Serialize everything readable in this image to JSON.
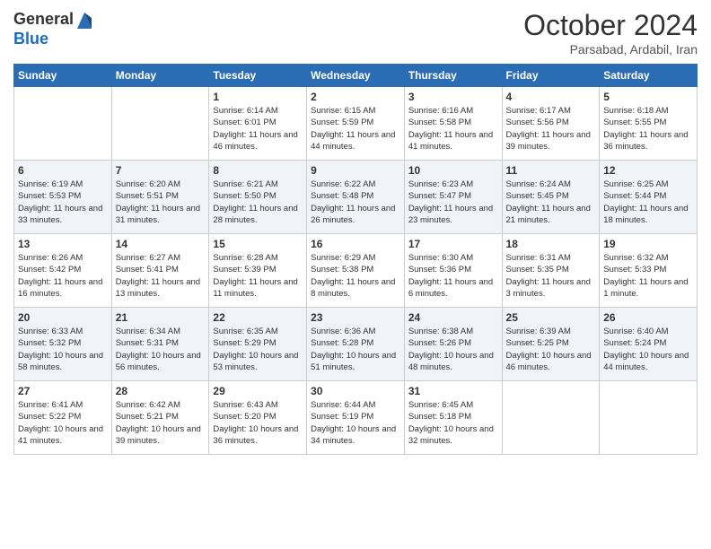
{
  "header": {
    "logo_line1": "General",
    "logo_line2": "Blue",
    "month": "October 2024",
    "location": "Parsabad, Ardabil, Iran"
  },
  "days_of_week": [
    "Sunday",
    "Monday",
    "Tuesday",
    "Wednesday",
    "Thursday",
    "Friday",
    "Saturday"
  ],
  "weeks": [
    [
      {
        "day": "",
        "info": ""
      },
      {
        "day": "",
        "info": ""
      },
      {
        "day": "1",
        "info": "Sunrise: 6:14 AM\nSunset: 6:01 PM\nDaylight: 11 hours and 46 minutes."
      },
      {
        "day": "2",
        "info": "Sunrise: 6:15 AM\nSunset: 5:59 PM\nDaylight: 11 hours and 44 minutes."
      },
      {
        "day": "3",
        "info": "Sunrise: 6:16 AM\nSunset: 5:58 PM\nDaylight: 11 hours and 41 minutes."
      },
      {
        "day": "4",
        "info": "Sunrise: 6:17 AM\nSunset: 5:56 PM\nDaylight: 11 hours and 39 minutes."
      },
      {
        "day": "5",
        "info": "Sunrise: 6:18 AM\nSunset: 5:55 PM\nDaylight: 11 hours and 36 minutes."
      }
    ],
    [
      {
        "day": "6",
        "info": "Sunrise: 6:19 AM\nSunset: 5:53 PM\nDaylight: 11 hours and 33 minutes."
      },
      {
        "day": "7",
        "info": "Sunrise: 6:20 AM\nSunset: 5:51 PM\nDaylight: 11 hours and 31 minutes."
      },
      {
        "day": "8",
        "info": "Sunrise: 6:21 AM\nSunset: 5:50 PM\nDaylight: 11 hours and 28 minutes."
      },
      {
        "day": "9",
        "info": "Sunrise: 6:22 AM\nSunset: 5:48 PM\nDaylight: 11 hours and 26 minutes."
      },
      {
        "day": "10",
        "info": "Sunrise: 6:23 AM\nSunset: 5:47 PM\nDaylight: 11 hours and 23 minutes."
      },
      {
        "day": "11",
        "info": "Sunrise: 6:24 AM\nSunset: 5:45 PM\nDaylight: 11 hours and 21 minutes."
      },
      {
        "day": "12",
        "info": "Sunrise: 6:25 AM\nSunset: 5:44 PM\nDaylight: 11 hours and 18 minutes."
      }
    ],
    [
      {
        "day": "13",
        "info": "Sunrise: 6:26 AM\nSunset: 5:42 PM\nDaylight: 11 hours and 16 minutes."
      },
      {
        "day": "14",
        "info": "Sunrise: 6:27 AM\nSunset: 5:41 PM\nDaylight: 11 hours and 13 minutes."
      },
      {
        "day": "15",
        "info": "Sunrise: 6:28 AM\nSunset: 5:39 PM\nDaylight: 11 hours and 11 minutes."
      },
      {
        "day": "16",
        "info": "Sunrise: 6:29 AM\nSunset: 5:38 PM\nDaylight: 11 hours and 8 minutes."
      },
      {
        "day": "17",
        "info": "Sunrise: 6:30 AM\nSunset: 5:36 PM\nDaylight: 11 hours and 6 minutes."
      },
      {
        "day": "18",
        "info": "Sunrise: 6:31 AM\nSunset: 5:35 PM\nDaylight: 11 hours and 3 minutes."
      },
      {
        "day": "19",
        "info": "Sunrise: 6:32 AM\nSunset: 5:33 PM\nDaylight: 11 hours and 1 minute."
      }
    ],
    [
      {
        "day": "20",
        "info": "Sunrise: 6:33 AM\nSunset: 5:32 PM\nDaylight: 10 hours and 58 minutes."
      },
      {
        "day": "21",
        "info": "Sunrise: 6:34 AM\nSunset: 5:31 PM\nDaylight: 10 hours and 56 minutes."
      },
      {
        "day": "22",
        "info": "Sunrise: 6:35 AM\nSunset: 5:29 PM\nDaylight: 10 hours and 53 minutes."
      },
      {
        "day": "23",
        "info": "Sunrise: 6:36 AM\nSunset: 5:28 PM\nDaylight: 10 hours and 51 minutes."
      },
      {
        "day": "24",
        "info": "Sunrise: 6:38 AM\nSunset: 5:26 PM\nDaylight: 10 hours and 48 minutes."
      },
      {
        "day": "25",
        "info": "Sunrise: 6:39 AM\nSunset: 5:25 PM\nDaylight: 10 hours and 46 minutes."
      },
      {
        "day": "26",
        "info": "Sunrise: 6:40 AM\nSunset: 5:24 PM\nDaylight: 10 hours and 44 minutes."
      }
    ],
    [
      {
        "day": "27",
        "info": "Sunrise: 6:41 AM\nSunset: 5:22 PM\nDaylight: 10 hours and 41 minutes."
      },
      {
        "day": "28",
        "info": "Sunrise: 6:42 AM\nSunset: 5:21 PM\nDaylight: 10 hours and 39 minutes."
      },
      {
        "day": "29",
        "info": "Sunrise: 6:43 AM\nSunset: 5:20 PM\nDaylight: 10 hours and 36 minutes."
      },
      {
        "day": "30",
        "info": "Sunrise: 6:44 AM\nSunset: 5:19 PM\nDaylight: 10 hours and 34 minutes."
      },
      {
        "day": "31",
        "info": "Sunrise: 6:45 AM\nSunset: 5:18 PM\nDaylight: 10 hours and 32 minutes."
      },
      {
        "day": "",
        "info": ""
      },
      {
        "day": "",
        "info": ""
      }
    ]
  ]
}
